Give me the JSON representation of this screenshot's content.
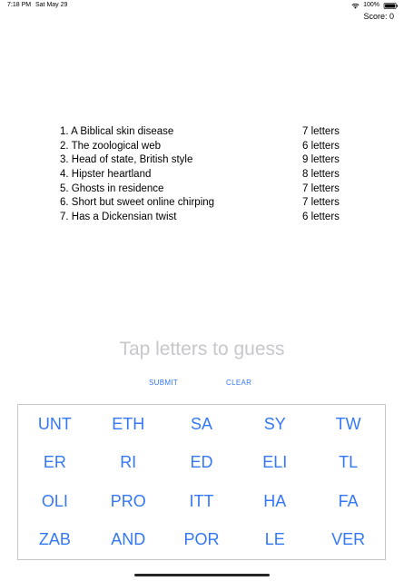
{
  "status_bar": {
    "time": "7:18 PM",
    "date": "Sat May 29",
    "battery_text": "100%",
    "wifi_icon": "wifi-icon",
    "battery_icon": "battery-icon"
  },
  "score_text": "Score: 0",
  "clues": [
    {
      "text": "1. A Biblical skin disease",
      "length": "7 letters"
    },
    {
      "text": "2. The zoological web",
      "length": "6 letters"
    },
    {
      "text": "3. Head of state, British style",
      "length": "9 letters"
    },
    {
      "text": "4. Hipster heartland",
      "length": "8 letters"
    },
    {
      "text": "5. Ghosts in residence",
      "length": "7 letters"
    },
    {
      "text": "6. Short but sweet online chirping",
      "length": "7 letters"
    },
    {
      "text": "7. Has a Dickensian twist",
      "length": "6 letters"
    }
  ],
  "guess_placeholder": "Tap letters to guess",
  "actions": {
    "submit": "SUBMIT",
    "clear": "CLEAR"
  },
  "tiles": [
    "UNT",
    "ETH",
    "SA",
    "SY",
    "TW",
    "ER",
    "RI",
    "ED",
    "ELI",
    "TL",
    "OLI",
    "PRO",
    "ITT",
    "HA",
    "FA",
    "ZAB",
    "AND",
    "POR",
    "LE",
    "VER"
  ],
  "colors": {
    "accent": "#3478f6",
    "placeholder": "#c7c7cc",
    "border": "#c6c6c8"
  }
}
